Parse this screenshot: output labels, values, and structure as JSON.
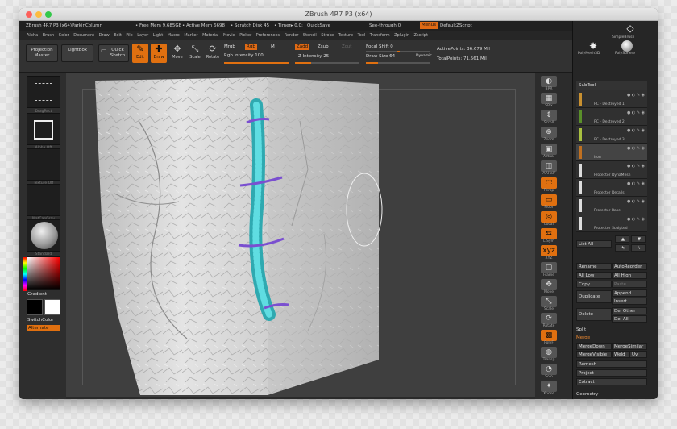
{
  "window": {
    "title": "ZBrush 4R7 P3 (x64)"
  },
  "status": {
    "doc": "ZBrush 4R7 P3 (x64)ParkinColumn",
    "free_mem": "• Free Mem 9.685GB",
    "active_mem": "• Active Mem 6698",
    "scratch": "• Scratch Disk 45",
    "timer": "• Timer▸ 0.0:",
    "quicksave": "QuickSave",
    "seethrough": "See-through  0",
    "menus": "Menus",
    "script": "DefaultZScript"
  },
  "menu": [
    "Alpha",
    "Brush",
    "Color",
    "Document",
    "Draw",
    "Edit",
    "File",
    "Layer",
    "Light",
    "Macro",
    "Marker",
    "Material",
    "Movie",
    "Picker",
    "Preferences",
    "Render",
    "Stencil",
    "Stroke",
    "Texture",
    "Tool",
    "Transform",
    "Zplugin",
    "Zscript"
  ],
  "toolbar": {
    "projection_master": "Projection Master",
    "lightbox": "LightBox",
    "quick_sketch": "Quick Sketch",
    "edit": "Edit",
    "draw": "Draw",
    "move": "Move",
    "scale": "Scale",
    "rotate": "Rotate",
    "mrgb": "Mrgb",
    "rgb": "Rgb",
    "m": "M",
    "rgb_intensity": "Rgb Intensity 100",
    "zadd": "Zadd",
    "zsub": "Zsub",
    "zcut": "Zcut",
    "z_intensity": "Z Intensity 25",
    "focal_shift": "Focal Shift 0",
    "draw_size": "Draw Size 64",
    "dynamic": "Dynamic",
    "active_points": "ActivePoints: 36.679 Mil",
    "total_points": "TotalPoints: 71.561 Mil",
    "rgb_intensity_value": 100,
    "z_intensity_value": 25,
    "draw_size_value": 64
  },
  "left": {
    "stroke_label": "DragRect",
    "alpha_label": "Alpha Off",
    "texture_label": "Texture Off",
    "material_label": "MatCapGray",
    "brush_label": "Standard",
    "gradient": "Gradient",
    "switch_color": "SwitchColor",
    "alternate": "Alternate"
  },
  "right_shelf": [
    "BPR",
    "SPix",
    "Scroll",
    "Zoom",
    "Actual",
    "AAHalf",
    "Persp",
    "Floor",
    "Local",
    "L.Sym",
    "XYZ",
    "Frame",
    "Move",
    "Scale",
    "Rotate",
    "PolyF",
    "Transp",
    "Solo",
    "Xpose"
  ],
  "panel": {
    "top_tools": [
      "SimpleBrush",
      "PolyMesh3D",
      "PolySphere"
    ],
    "subtool_title": "SubTool",
    "subtools": [
      "PC - Destroyed 1",
      "PC - Destroyed 2",
      "PC - Destroyed 3",
      "Iron",
      "Protector DynaMesh",
      "Protector Details",
      "Protector Base",
      "Protector Sculpted"
    ],
    "list_all": "List All",
    "rename": "Rename",
    "auto_reorder": "AutoReorder",
    "all_low": "All Low",
    "all_high": "All High",
    "copy": "Copy",
    "paste": "Paste",
    "duplicate": "Duplicate",
    "append": "Append",
    "insert": "Insert",
    "delete": "Delete",
    "del_other": "Del Other",
    "del_all": "Del All",
    "split": "Split",
    "merge": "Merge",
    "merge_down": "MergeDown",
    "merge_similar": "MergeSimilar",
    "merge_visible": "MergeVisible",
    "weld": "Weld",
    "uv": "Uv",
    "remesh": "Remesh",
    "project": "Project",
    "extract": "Extract",
    "geometry": "Geometry"
  },
  "colors": {
    "accent": "#e07010",
    "model": "#d6d6d6",
    "tube": "#4fd2d8",
    "ring": "#7a4fd0"
  }
}
